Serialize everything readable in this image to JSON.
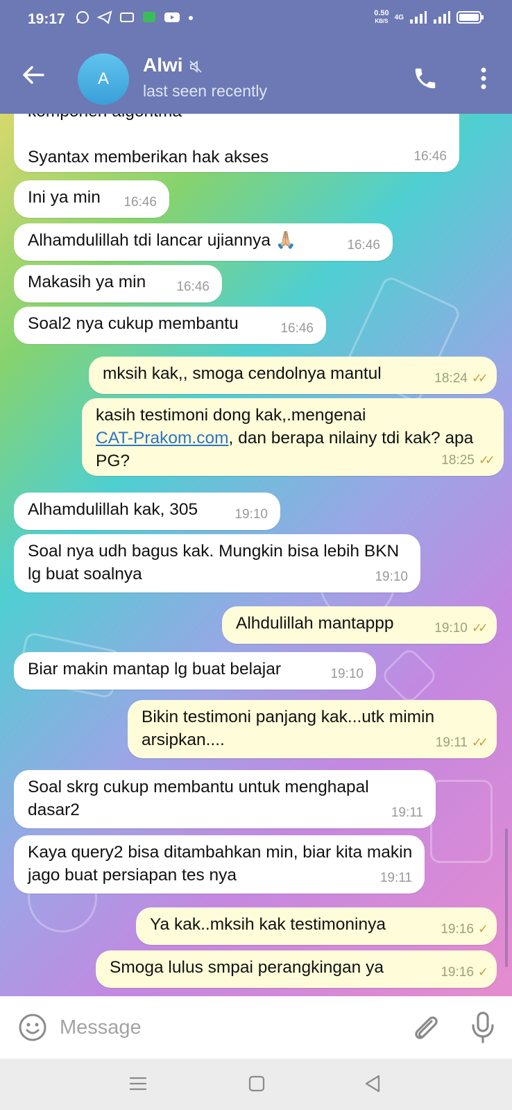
{
  "status_bar": {
    "time": "19:17",
    "network_speed": "0.50",
    "network_unit": "KB/S",
    "network_type": "4G"
  },
  "header": {
    "avatar_letter": "A",
    "name": "Alwi",
    "status": "last seen recently"
  },
  "messages": [
    {
      "dir": "in",
      "text": "komponen algoritma\n\nSyantax memberikan hak akses",
      "time": "16:46"
    },
    {
      "dir": "in",
      "text": "Ini ya min",
      "time": "16:46"
    },
    {
      "dir": "in",
      "text": "Alhamdulillah tdi lancar ujiannya 🙏🏼",
      "time": "16:46"
    },
    {
      "dir": "in",
      "text": "Makasih ya min",
      "time": "16:46"
    },
    {
      "dir": "in",
      "text": "Soal2 nya cukup membantu",
      "time": "16:46"
    },
    {
      "dir": "out",
      "text": "mksih kak,, smoga cendolnya mantul",
      "time": "18:24",
      "status": "read"
    },
    {
      "dir": "out",
      "text_before": "kasih testimoni dong kak,.mengenai",
      "link": "CAT-Prakom.com",
      "text_after": ", dan berapa nilainy tdi kak? apa PG?",
      "time": "18:25",
      "status": "read"
    },
    {
      "dir": "in",
      "text": "Alhamdulillah kak, 305",
      "time": "19:10"
    },
    {
      "dir": "in",
      "text": "Soal nya udh bagus kak. Mungkin bisa lebih BKN lg buat soalnya",
      "time": "19:10"
    },
    {
      "dir": "out",
      "text": "Alhdulillah mantappp",
      "time": "19:10",
      "status": "read"
    },
    {
      "dir": "in",
      "text": "Biar makin mantap lg buat belajar",
      "time": "19:10"
    },
    {
      "dir": "out",
      "text": "Bikin testimoni panjang kak...utk mimin arsipkan....",
      "time": "19:11",
      "status": "read"
    },
    {
      "dir": "in",
      "text": "Soal skrg cukup membantu untuk menghapal dasar2",
      "time": "19:11"
    },
    {
      "dir": "in",
      "text": "Kaya query2 bisa ditambahkan min, biar kita makin jago buat persiapan tes nya",
      "time": "19:11"
    },
    {
      "dir": "out",
      "text": "Ya kak..mksih kak testimoninya",
      "time": "19:16",
      "status": "sent"
    },
    {
      "dir": "out",
      "text": "Smoga lulus smpai perangkingan ya",
      "time": "19:16",
      "status": "sent"
    }
  ],
  "input": {
    "placeholder": "Message"
  },
  "icons": {
    "back": "arrow-left-icon",
    "mute": "muted-speaker-icon",
    "call": "phone-icon",
    "menu": "more-vertical-icon",
    "emoji": "emoji-icon",
    "attach": "paperclip-icon",
    "mic": "microphone-icon"
  },
  "colors": {
    "header": "#6c79b4",
    "incoming_bubble": "#ffffff",
    "outgoing_bubble": "#fefcd9",
    "read_ticks": "#c9a13f",
    "link": "#2a74c5"
  }
}
